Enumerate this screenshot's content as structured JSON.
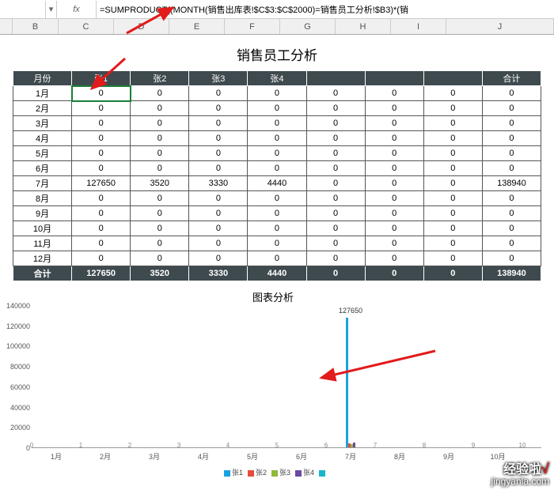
{
  "namebox": "",
  "fx_label": "fx",
  "formula": "=SUMPRODUCT((MONTH(销售出库表!$C$3:$C$2000)=销售员工分析!$B3)*(销",
  "col_headers": [
    "B",
    "C",
    "D",
    "E",
    "F",
    "G",
    "H",
    "I",
    "J"
  ],
  "title": "销售员工分析",
  "table": {
    "headers": [
      "月份",
      "张1",
      "张2",
      "张3",
      "张4",
      "",
      "",
      "",
      "合计"
    ],
    "rows": [
      {
        "m": "1月",
        "v": [
          0,
          0,
          0,
          0,
          0,
          0,
          0,
          0
        ]
      },
      {
        "m": "2月",
        "v": [
          0,
          0,
          0,
          0,
          0,
          0,
          0,
          0
        ]
      },
      {
        "m": "3月",
        "v": [
          0,
          0,
          0,
          0,
          0,
          0,
          0,
          0
        ]
      },
      {
        "m": "4月",
        "v": [
          0,
          0,
          0,
          0,
          0,
          0,
          0,
          0
        ]
      },
      {
        "m": "5月",
        "v": [
          0,
          0,
          0,
          0,
          0,
          0,
          0,
          0
        ]
      },
      {
        "m": "6月",
        "v": [
          0,
          0,
          0,
          0,
          0,
          0,
          0,
          0
        ]
      },
      {
        "m": "7月",
        "v": [
          127650,
          3520,
          3330,
          4440,
          0,
          0,
          0,
          138940
        ]
      },
      {
        "m": "8月",
        "v": [
          0,
          0,
          0,
          0,
          0,
          0,
          0,
          0
        ]
      },
      {
        "m": "9月",
        "v": [
          0,
          0,
          0,
          0,
          0,
          0,
          0,
          0
        ]
      },
      {
        "m": "10月",
        "v": [
          0,
          0,
          0,
          0,
          0,
          0,
          0,
          0
        ]
      },
      {
        "m": "11月",
        "v": [
          0,
          0,
          0,
          0,
          0,
          0,
          0,
          0
        ]
      },
      {
        "m": "12月",
        "v": [
          0,
          0,
          0,
          0,
          0,
          0,
          0,
          0
        ]
      }
    ],
    "sum_label": "合计",
    "sums": [
      127650,
      3520,
      3330,
      4440,
      0,
      0,
      0,
      138940
    ]
  },
  "chart_title": "图表分析",
  "chart_data": {
    "type": "bar",
    "categories": [
      "1月",
      "2月",
      "3月",
      "4月",
      "5月",
      "6月",
      "7月",
      "8月",
      "9月",
      "10月"
    ],
    "series": [
      {
        "name": "张1",
        "color": "#1ba1e2",
        "values": [
          0,
          0,
          0,
          0,
          0,
          0,
          127650,
          0,
          0,
          0
        ]
      },
      {
        "name": "张2",
        "color": "#e84c3d",
        "values": [
          0,
          0,
          0,
          0,
          0,
          0,
          3520,
          0,
          0,
          0
        ]
      },
      {
        "name": "张3",
        "color": "#8fb93b",
        "values": [
          0,
          0,
          0,
          0,
          0,
          0,
          3330,
          0,
          0,
          0
        ]
      },
      {
        "name": "张4",
        "color": "#6b4aa0",
        "values": [
          0,
          0,
          0,
          0,
          0,
          0,
          4440,
          0,
          0,
          0
        ]
      }
    ],
    "ylim": [
      0,
      140000
    ],
    "yticks": [
      0,
      20000,
      40000,
      60000,
      80000,
      100000,
      120000,
      140000
    ],
    "data_label": "127650"
  },
  "watermark": {
    "line1": "经验啦",
    "check": "√",
    "line2": "jingyanla.com"
  }
}
